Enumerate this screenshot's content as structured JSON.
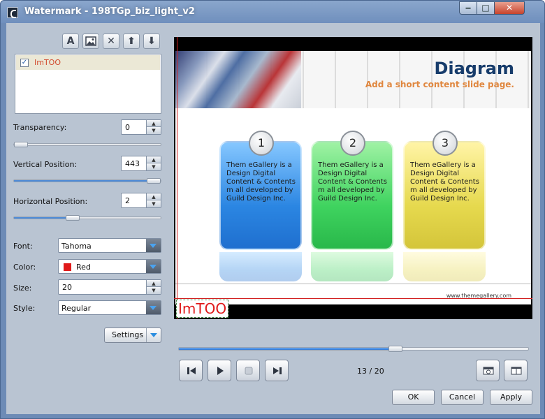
{
  "window": {
    "title": "Watermark - 198TGp_biz_light_v2"
  },
  "toolbar": {
    "icons": [
      "text-icon",
      "image-icon",
      "delete-icon",
      "arrow-up-icon",
      "arrow-down-icon"
    ]
  },
  "watermark_list": {
    "items": [
      {
        "label": "ImTOO",
        "checked": true
      }
    ]
  },
  "controls": {
    "transparency": {
      "label": "Transparency:",
      "value": "0",
      "level": 0
    },
    "vertical": {
      "label": "Vertical Position:",
      "value": "443",
      "level": 0.95
    },
    "horizontal": {
      "label": "Horizontal Position:",
      "value": "2",
      "level": 0.4
    },
    "font": {
      "label": "Font:",
      "value": "Tahoma"
    },
    "color": {
      "label": "Color:",
      "value": "Red",
      "swatch": "#e01a1a"
    },
    "size": {
      "label": "Size:",
      "value": "20"
    },
    "style": {
      "label": "Style:",
      "value": "Regular"
    },
    "settings_label": "Settings"
  },
  "preview": {
    "slide_title": "Diagram",
    "slide_subtitle": "Add a short content slide page.",
    "cards": [
      {
        "num": "1",
        "text": "Them eGallery is a Design Digital Content & Contents m all developed by Guild Design Inc."
      },
      {
        "num": "2",
        "text": "Them eGallery is a Design Digital Content & Contents m all developed by Guild Design Inc."
      },
      {
        "num": "3",
        "text": "Them eGallery is a Design Digital Content & Contents m all developed by Guild Design Inc."
      }
    ],
    "footer_url": "www.themegallery.com",
    "watermark_text": "ImTOO",
    "watermark_color": "#e01a1a"
  },
  "playback": {
    "page": "13 / 20",
    "progress": 0.62
  },
  "buttons": {
    "ok": "OK",
    "cancel": "Cancel",
    "apply": "Apply"
  }
}
